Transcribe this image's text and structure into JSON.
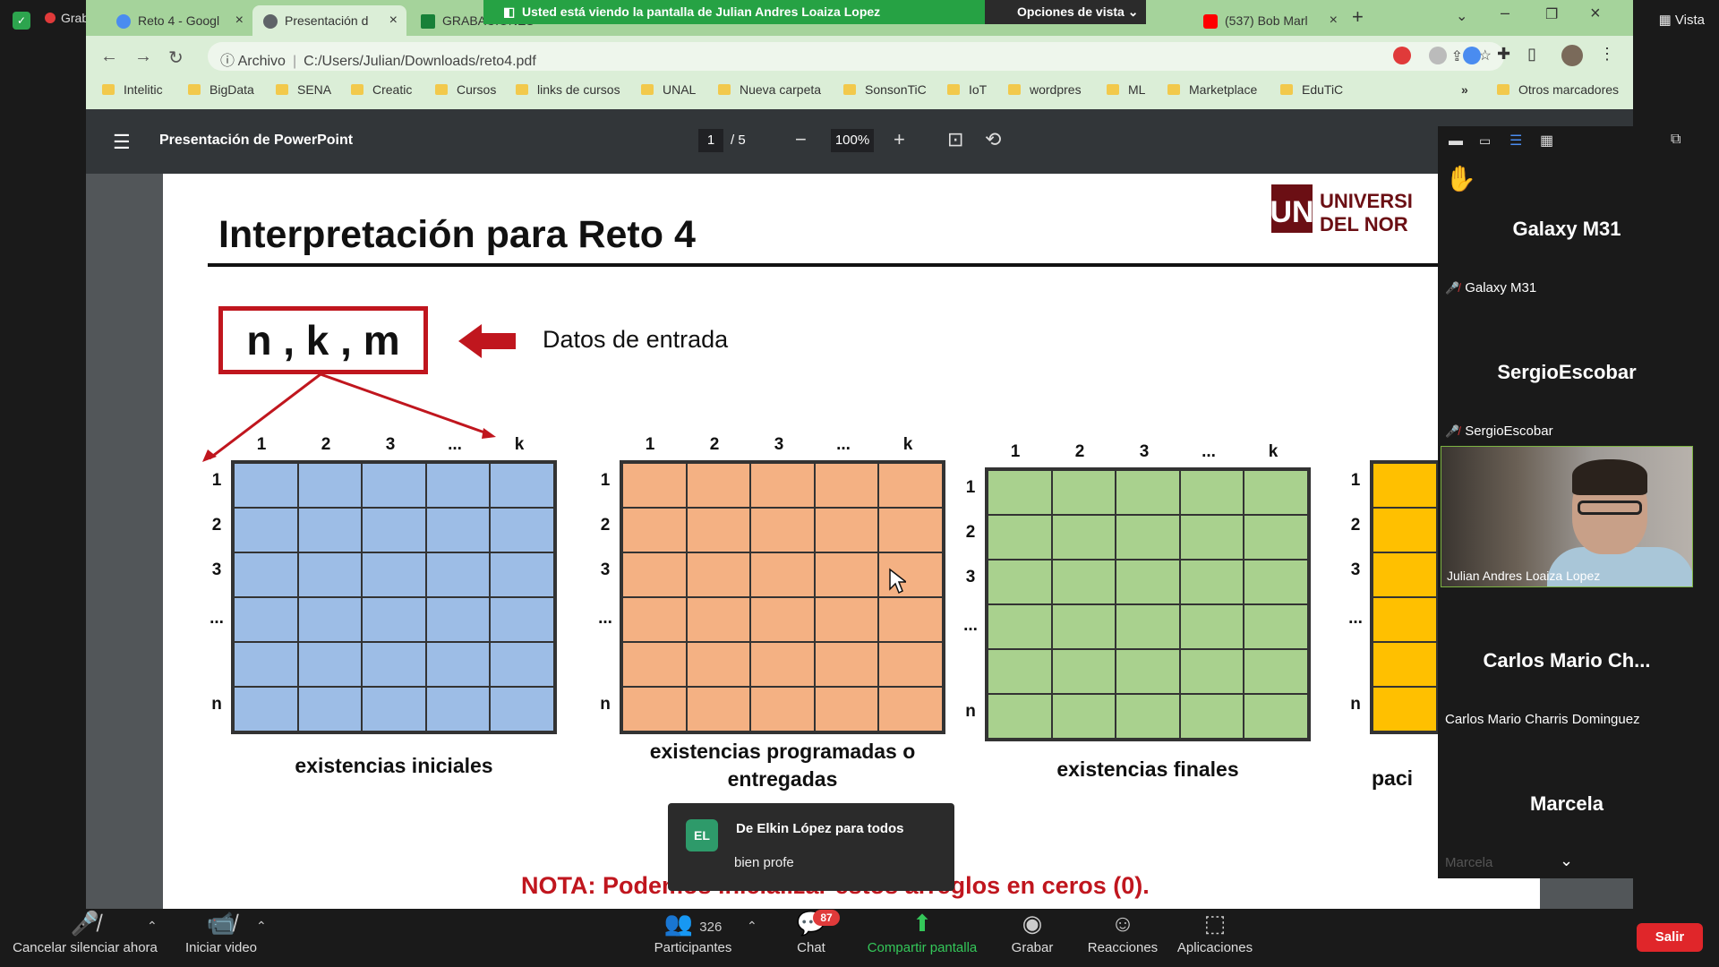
{
  "zoom": {
    "recording_label": "Grabando",
    "view_label": "Vista",
    "share_banner": "Usted está viendo la pantalla de Julian Andres Loaiza Lopez",
    "view_options": "Opciones de vista",
    "toolbar": {
      "unmute": "Cancelar silenciar ahora",
      "start_video": "Iniciar video",
      "participants": "Participantes",
      "participants_count": "326",
      "chat": "Chat",
      "chat_badge": "87",
      "share_screen": "Compartir pantalla",
      "record": "Grabar",
      "reactions": "Reacciones",
      "apps": "Aplicaciones",
      "leave": "Salir"
    },
    "chat_popup": {
      "avatar": "EL",
      "from": "De Elkin López para todos",
      "message": "bien profe"
    },
    "participants_panel": {
      "tiles": [
        {
          "big": "Galaxy M31",
          "small": "Galaxy M31"
        },
        {
          "big": "SergioEscobar",
          "small": "SergioEscobar"
        },
        {
          "big": "",
          "small": "Julian Andres Loaiza Lopez"
        },
        {
          "big": "Carlos Mario Ch...",
          "small": "Carlos Mario Charris Dominguez"
        },
        {
          "big": "Marcela",
          "small": "Marcela"
        }
      ]
    }
  },
  "browser": {
    "tabs": [
      {
        "label": "Reto 4 - Googl"
      },
      {
        "label": "Presentación d"
      },
      {
        "label": "GRABACIONES"
      },
      {
        "label": "(537) Bob Marl"
      }
    ],
    "address": {
      "prefix": "Archivo",
      "url": "C:/Users/Julian/Downloads/reto4.pdf"
    },
    "bookmarks": [
      "Intelitic",
      "BigData",
      "SENA",
      "Creatic",
      "Cursos",
      "links de cursos",
      "UNAL",
      "Nueva carpeta",
      "SonsonTiC",
      "IoT",
      "wordpres",
      "ML",
      "Marketplace",
      "EduTiC"
    ],
    "bookmarks_more": "»",
    "bookmarks_other": "Otros marcadores"
  },
  "pdf": {
    "title": "Presentación de PowerPoint",
    "page_current": "1",
    "page_total": "/ 5",
    "zoom": "100%"
  },
  "slide": {
    "title": "Interpretación para Reto 4",
    "logo": "UNIVERSI DEL NOR",
    "inputs_box": "n , k , m",
    "inputs_label": "Datos de entrada",
    "col_headers": [
      "1",
      "2",
      "3",
      "...",
      "k"
    ],
    "row_headers": [
      "1",
      "2",
      "3",
      "...",
      "n"
    ],
    "grids": [
      {
        "label": "existencias iniciales",
        "color": "#9dbde6"
      },
      {
        "label": "existencias programadas o entregadas",
        "color": "#f4b183"
      },
      {
        "label": "existencias finales",
        "color": "#a9d18e"
      },
      {
        "label": "paci",
        "color": "#ffc000"
      }
    ],
    "note": "NOTA: Podemos inicializar estos arreglos en ceros (0)."
  }
}
